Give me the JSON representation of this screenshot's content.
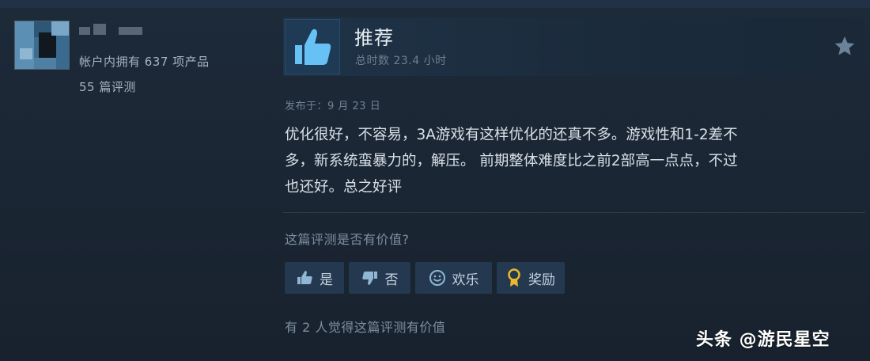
{
  "reviewer": {
    "products_owned_text": "帐户内拥有 637 项产品",
    "reviews_count_text": "55 篇评测"
  },
  "review": {
    "verdict": "推荐",
    "hours": "总时数 23.4 小时",
    "posted_date": "发布于：9 月 23 日",
    "body_lines": [
      "优化很好，不容易，3A游戏有这样优化的还真不多。游戏性和1-2差不",
      "多，新系统蛮暴力的，解压。 前期整体难度比之前2部高一点点，不过",
      "也还好。总之好评"
    ]
  },
  "feedback": {
    "question": "这篇评测是否有价值?",
    "buttons": {
      "yes": "是",
      "no": "否",
      "funny": "欢乐",
      "award": "奖励"
    },
    "helpful_count_text": "有 2 人觉得这篇评测有价值"
  },
  "watermark": "头条 @游民星空",
  "colors": {
    "background": "#1b2838",
    "button_bg": "#24394f",
    "thumb_blue": "#67c1f5",
    "award_gold": "#e8b92c"
  },
  "icons": [
    "thumbs-up-icon",
    "star-icon",
    "thumbs-down-icon",
    "smiley-icon",
    "award-ribbon-icon"
  ]
}
